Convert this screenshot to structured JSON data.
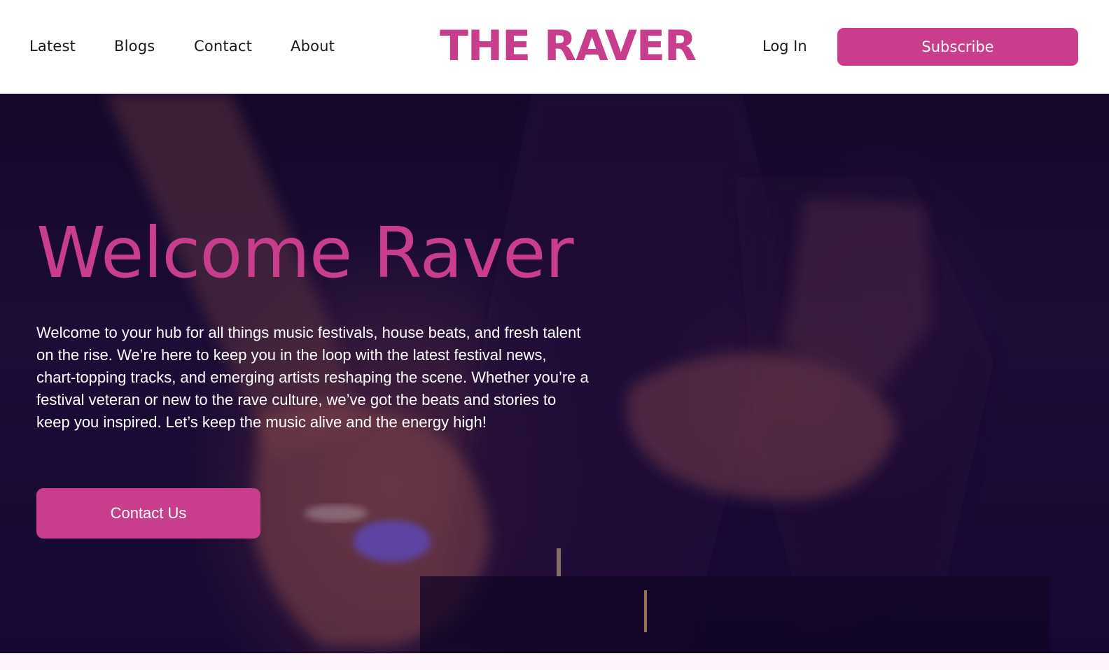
{
  "nav": {
    "items": [
      {
        "label": "Latest"
      },
      {
        "label": "Blogs"
      },
      {
        "label": "Contact"
      },
      {
        "label": "About"
      }
    ]
  },
  "brand": {
    "logo_text": "THE RAVER"
  },
  "auth": {
    "login_label": "Log In",
    "subscribe_label": "Subscribe"
  },
  "hero": {
    "title": "Welcome Raver",
    "body": "Welcome to your hub for all things music festivals, house beats, and fresh talent on the rise. We’re here to keep you in the loop with the latest festival news, chart-topping tracks, and emerging artists reshaping the scene. Whether you’re a festival veteran or new to the rave culture, we’ve got the beats and stories to keep you inspired. Let’s keep the music alive and the energy high!",
    "cta_label": "Contact Us",
    "background_image": "dj-hands-on-mixer-photo"
  },
  "colors": {
    "accent": "#c83d8c",
    "header_bg": "#ffffff",
    "hero_bg": "#1a0b33",
    "page_bg": "#fdf4fb"
  }
}
